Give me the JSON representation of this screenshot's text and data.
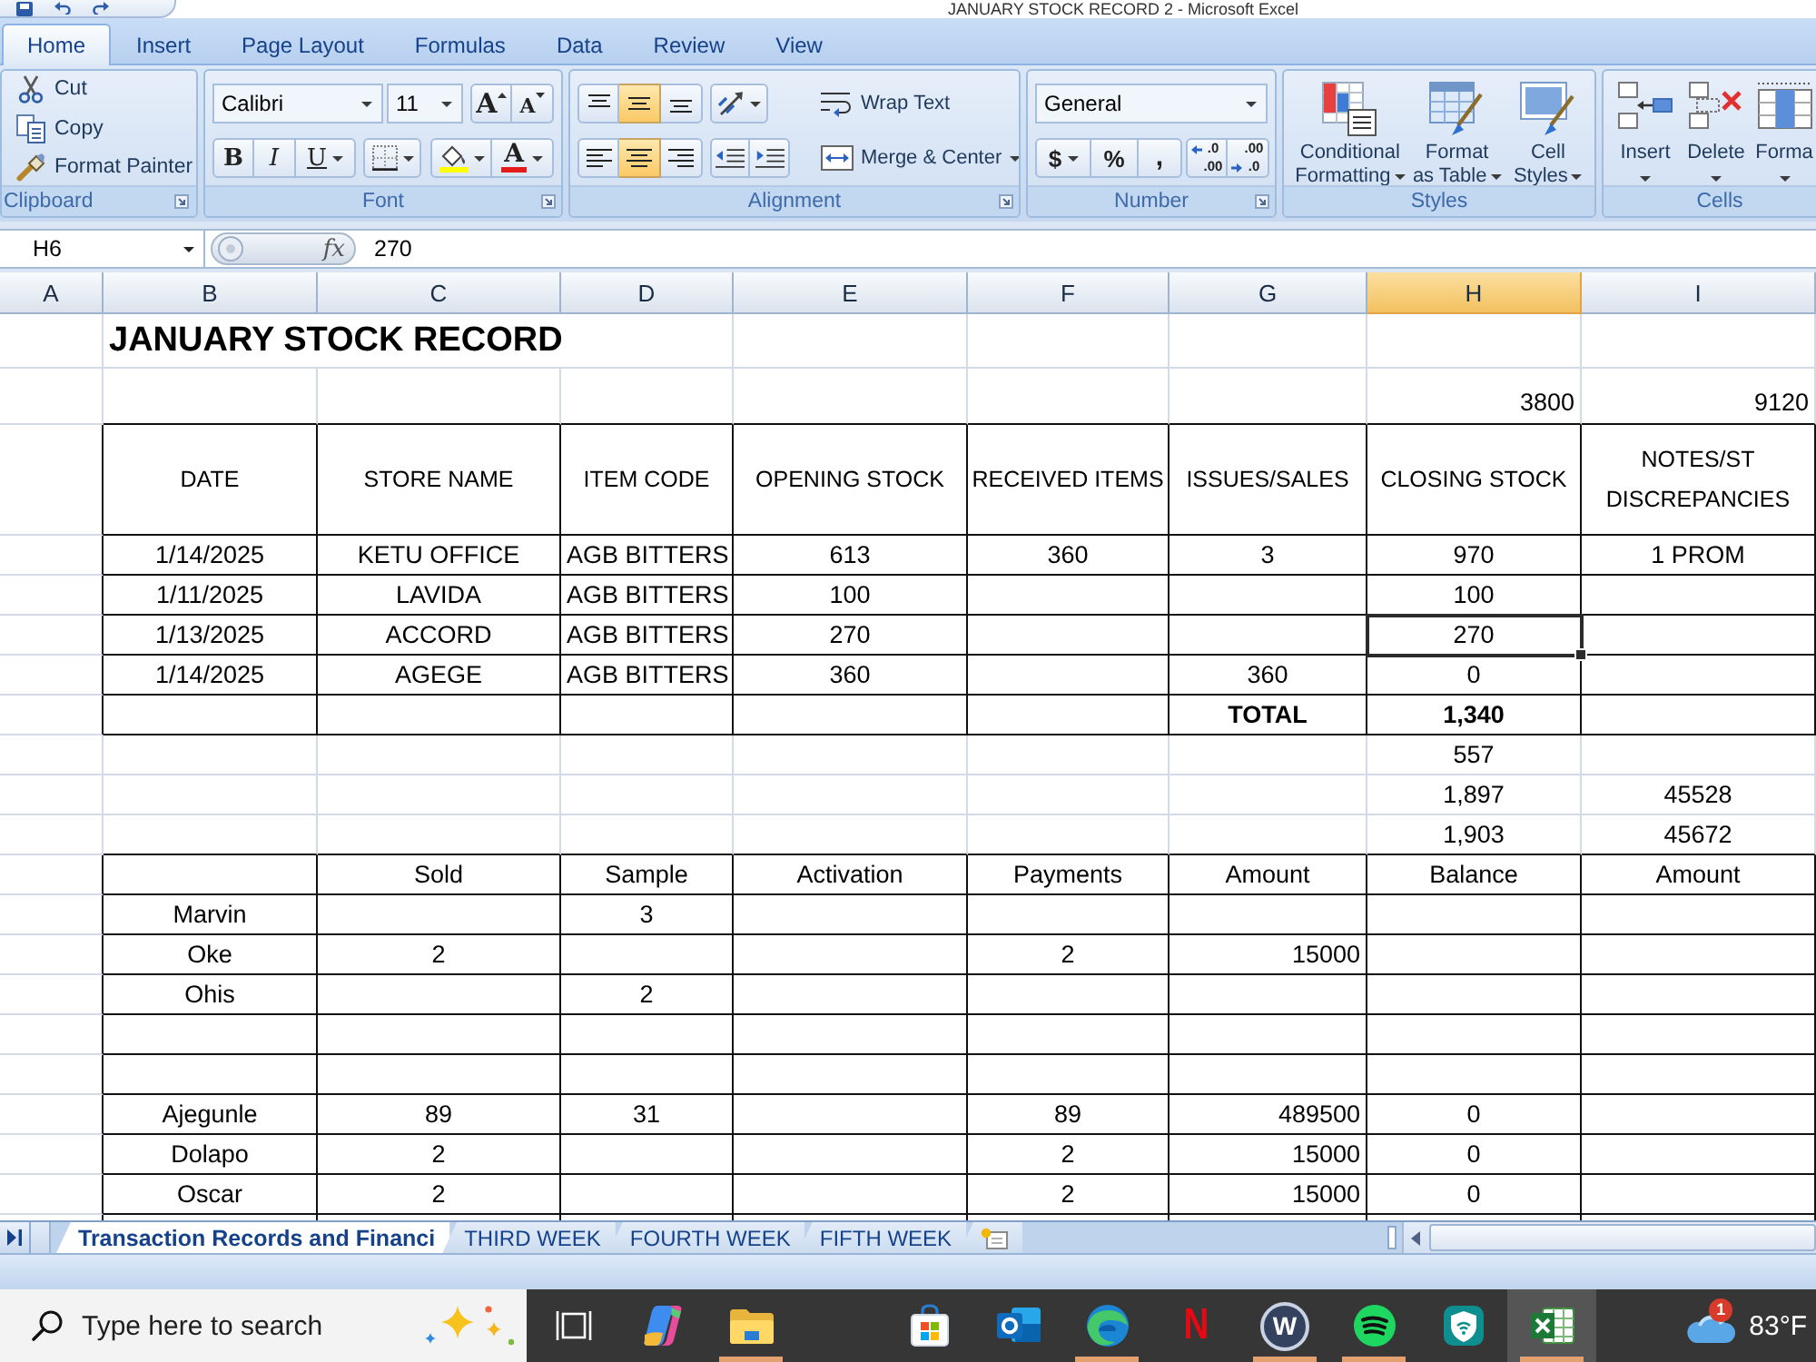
{
  "window": {
    "title": "JANUARY STOCK RECORD 2 - Microsoft Excel"
  },
  "ribbon": {
    "tabs": [
      {
        "label": "Home",
        "selected": true
      },
      {
        "label": "Insert",
        "selected": false
      },
      {
        "label": "Page Layout",
        "selected": false
      },
      {
        "label": "Formulas",
        "selected": false
      },
      {
        "label": "Data",
        "selected": false
      },
      {
        "label": "Review",
        "selected": false
      },
      {
        "label": "View",
        "selected": false
      }
    ],
    "groups": [
      {
        "kind": "clipboard",
        "label": "Clipboard",
        "launcher": true,
        "buttons": [
          {
            "kind": "cut",
            "label": "Cut"
          },
          {
            "kind": "copy",
            "label": "Copy"
          },
          {
            "kind": "painter",
            "label": "Format Painter"
          }
        ]
      },
      {
        "kind": "font",
        "label": "Font",
        "launcher": true,
        "font_name": "Calibri",
        "font_size": "11",
        "grow_label": "A",
        "shrink_label": "A",
        "bold_label": "B",
        "italic_label": "I",
        "underline_label": "U",
        "font_color_label": "A"
      },
      {
        "kind": "alignment",
        "label": "Alignment",
        "launcher": true,
        "vertical": [
          {
            "kind": "top",
            "selected": false
          },
          {
            "kind": "middle",
            "selected": true
          },
          {
            "kind": "bottom",
            "selected": false
          }
        ],
        "horizontal": [
          {
            "kind": "left",
            "selected": false
          },
          {
            "kind": "center",
            "selected": true
          },
          {
            "kind": "right",
            "selected": false
          }
        ],
        "wrap_label": "Wrap Text",
        "merge_label": "Merge & Center"
      },
      {
        "kind": "number",
        "label": "Number",
        "launcher": true,
        "format": "General",
        "currency_label": "$",
        "percent_label": "%",
        "comma_label": ",",
        "increase_decimal": [
          ".0",
          ".00"
        ],
        "decrease_decimal": [
          ".00",
          ".0"
        ]
      },
      {
        "kind": "styles",
        "label": "Styles",
        "launcher": false,
        "buttons": [
          {
            "kind": "conditional",
            "lines": [
              "Conditional",
              "Formatting"
            ]
          },
          {
            "kind": "table",
            "lines": [
              "Format",
              "as Table"
            ]
          },
          {
            "kind": "cell",
            "lines": [
              "Cell",
              "Styles"
            ]
          }
        ]
      },
      {
        "kind": "cells",
        "label": "Cells",
        "launcher": false,
        "buttons": [
          {
            "kind": "insert",
            "label": "Insert"
          },
          {
            "kind": "delete",
            "label": "Delete"
          },
          {
            "kind": "format",
            "label": "Forma"
          }
        ]
      }
    ]
  },
  "formula_bar": {
    "name_box": "H6",
    "function_label": "fx",
    "value": "270"
  },
  "sheet": {
    "columns": [
      {
        "label": "A",
        "selected": false
      },
      {
        "label": "B",
        "selected": false
      },
      {
        "label": "C",
        "selected": false
      },
      {
        "label": "D",
        "selected": false
      },
      {
        "label": "E",
        "selected": false
      },
      {
        "label": "F",
        "selected": false
      },
      {
        "label": "G",
        "selected": false
      },
      {
        "label": "H",
        "selected": true
      },
      {
        "label": "I",
        "selected": false
      }
    ],
    "rows": [
      {
        "kind": "title",
        "selected": false,
        "cells": {
          "b": "JANUARY STOCK RECORD"
        }
      },
      {
        "kind": "figures",
        "selected": false,
        "cells": {
          "h": "3800",
          "i": "9120"
        }
      },
      {
        "kind": "header",
        "selected": false,
        "cells": {
          "b": "DATE",
          "c": "STORE NAME",
          "d": "ITEM CODE",
          "e": "OPENING STOCK",
          "f": "RECEIVED ITEMS",
          "g": "ISSUES/SALES",
          "h": "CLOSING STOCK",
          "i": "NOTES/ST DISCREPANCIES"
        }
      },
      {
        "kind": "entry",
        "selected": false,
        "cells": {
          "b": "1/14/2025",
          "c": "KETU OFFICE",
          "d": "AGB BITTERS",
          "e": "613",
          "f": "360",
          "g": "3",
          "h": "970",
          "i": "1 PROM"
        }
      },
      {
        "kind": "entry",
        "selected": false,
        "cells": {
          "b": "1/11/2025",
          "c": "LAVIDA",
          "d": "AGB BITTERS",
          "e": "100",
          "h": "100"
        }
      },
      {
        "kind": "entry",
        "selected": true,
        "cells": {
          "b": "1/13/2025",
          "c": "ACCORD",
          "d": "AGB BITTERS",
          "e": "270",
          "h": "270"
        }
      },
      {
        "kind": "entry",
        "selected": false,
        "cells": {
          "b": "1/14/2025",
          "c": "AGEGE",
          "d": "AGB BITTERS",
          "e": "360",
          "g": "360",
          "h": "0"
        }
      },
      {
        "kind": "total",
        "selected": false,
        "cells": {
          "g": "TOTAL",
          "h": "1,340"
        }
      },
      {
        "kind": "summary",
        "selected": false,
        "cells": {
          "h": "557"
        }
      },
      {
        "kind": "summary",
        "selected": false,
        "cells": {
          "h": "1,897",
          "i": "45528"
        }
      },
      {
        "kind": "summary",
        "selected": false,
        "cells": {
          "h": "1,903",
          "i": "45672"
        }
      },
      {
        "kind": "ledger-head",
        "selected": false,
        "cells": {
          "c": "Sold",
          "d": "Sample",
          "e": "Activation",
          "f": "Payments",
          "g": "Amount",
          "h": "Balance",
          "i": "Amount"
        }
      },
      {
        "kind": "ledger",
        "selected": false,
        "cells": {
          "b": "Marvin",
          "d": "3"
        }
      },
      {
        "kind": "ledger",
        "selected": false,
        "cells": {
          "b": "Oke",
          "c": "2",
          "f": "2",
          "g": "15000"
        }
      },
      {
        "kind": "ledger",
        "selected": false,
        "cells": {
          "b": "Ohis",
          "d": "2"
        }
      },
      {
        "kind": "ledger",
        "selected": false
      },
      {
        "kind": "ledger",
        "selected": false
      },
      {
        "kind": "ledger",
        "selected": false,
        "cells": {
          "b": "Ajegunle",
          "c": "89",
          "d": "31",
          "f": "89",
          "g": "489500",
          "h": "0"
        }
      },
      {
        "kind": "ledger",
        "selected": false,
        "cells": {
          "b": "Dolapo",
          "c": "2",
          "f": "2",
          "g": "15000",
          "h": "0"
        }
      },
      {
        "kind": "ledger",
        "selected": false,
        "cells": {
          "b": "Oscar",
          "c": "2",
          "f": "2",
          "g": "15000",
          "h": "0"
        }
      },
      {
        "kind": "ledger",
        "selected": false
      }
    ]
  },
  "sheet_tabs": [
    {
      "label": "Transaction Records and Financi",
      "selected": true
    },
    {
      "label": "THIRD WEEK",
      "selected": false
    },
    {
      "label": "FOURTH WEEK",
      "selected": false
    },
    {
      "label": "FIFTH WEEK",
      "selected": false
    }
  ],
  "taskbar": {
    "search": {
      "placeholder": "Type here to search"
    },
    "apps": [
      {
        "kind": "task-view",
        "running": false,
        "active": false
      },
      {
        "kind": "assistant",
        "running": false,
        "active": false
      },
      {
        "kind": "files",
        "running": true,
        "active": false
      },
      {
        "kind": "store",
        "running": false,
        "active": false
      },
      {
        "kind": "mail",
        "running": false,
        "active": false
      },
      {
        "kind": "browser",
        "running": true,
        "active": false
      },
      {
        "kind": "letter",
        "glyph": "N",
        "running": false,
        "active": false
      },
      {
        "kind": "circle-letter",
        "glyph": "W",
        "running": true,
        "active": false
      },
      {
        "kind": "music",
        "running": true,
        "active": false
      },
      {
        "kind": "vpn",
        "running": false,
        "active": false
      },
      {
        "kind": "spreadsheet",
        "running": true,
        "active": true
      }
    ],
    "weather": {
      "badge": "1",
      "temperature": "83°F"
    }
  }
}
